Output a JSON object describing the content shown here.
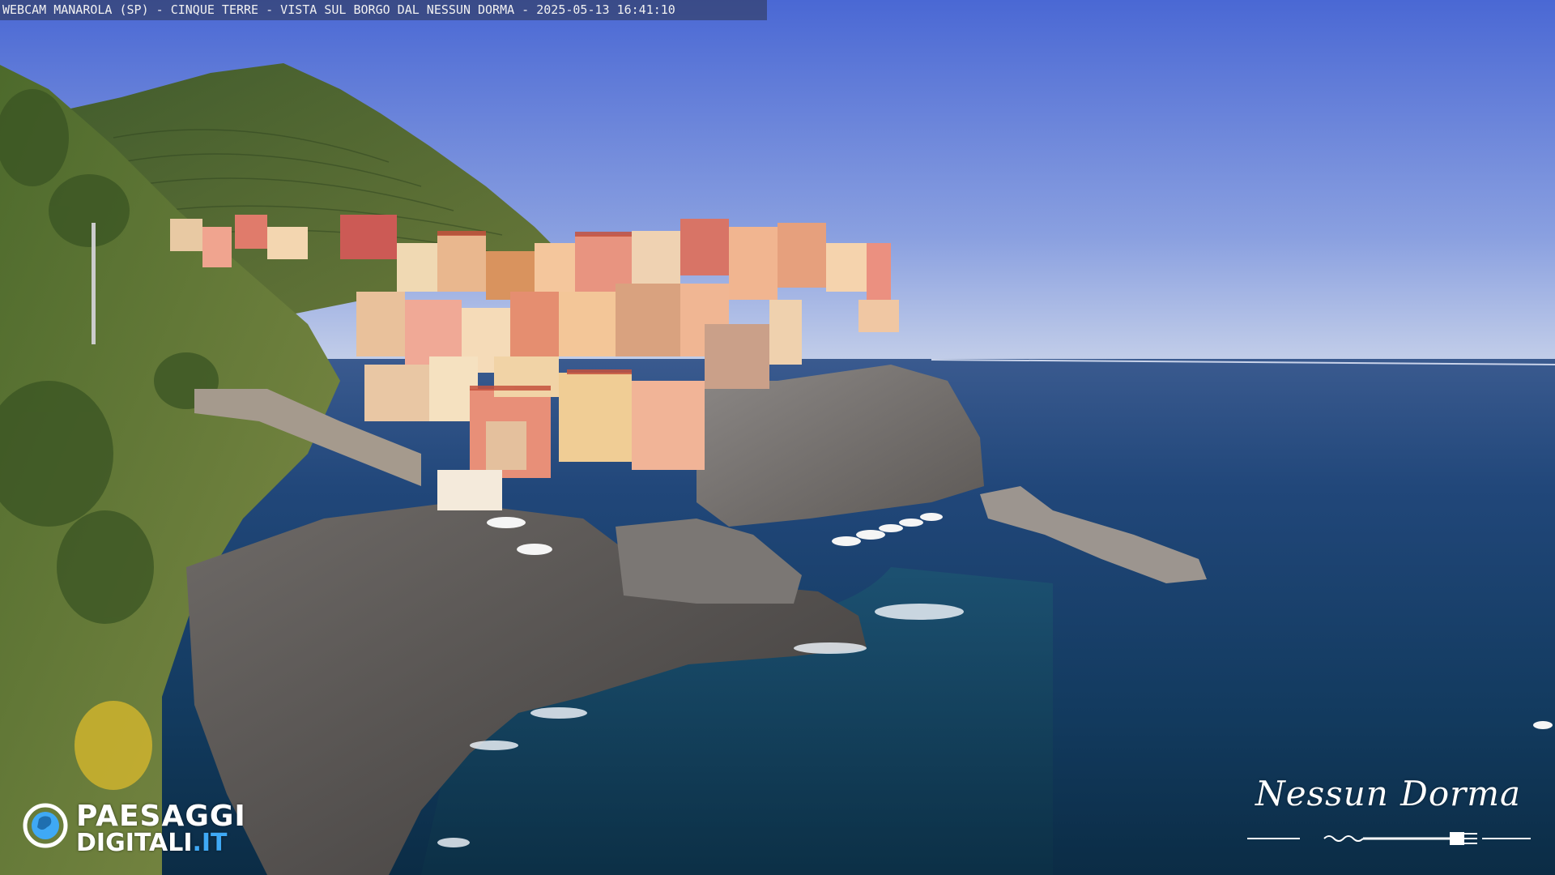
{
  "webcam": {
    "caption": "WEBCAM MANAROLA (SP) - CINQUE TERRE - VISTA SUL BORGO DAL NESSUN DORMA - 2025-05-13 16:41:10"
  },
  "logos": {
    "left_line1": "PAESAGGI",
    "left_line2_main": "DIGITALI",
    "left_line2_tld": ".IT",
    "right_script": "Nessun Dorma"
  },
  "colors": {
    "sky_top": "#4e6fd6",
    "sky_horizon": "#b6c4e8",
    "sea_deep": "#1d3f6e",
    "sea_near": "#0f3350",
    "logo_accent": "#3fa9f5"
  }
}
